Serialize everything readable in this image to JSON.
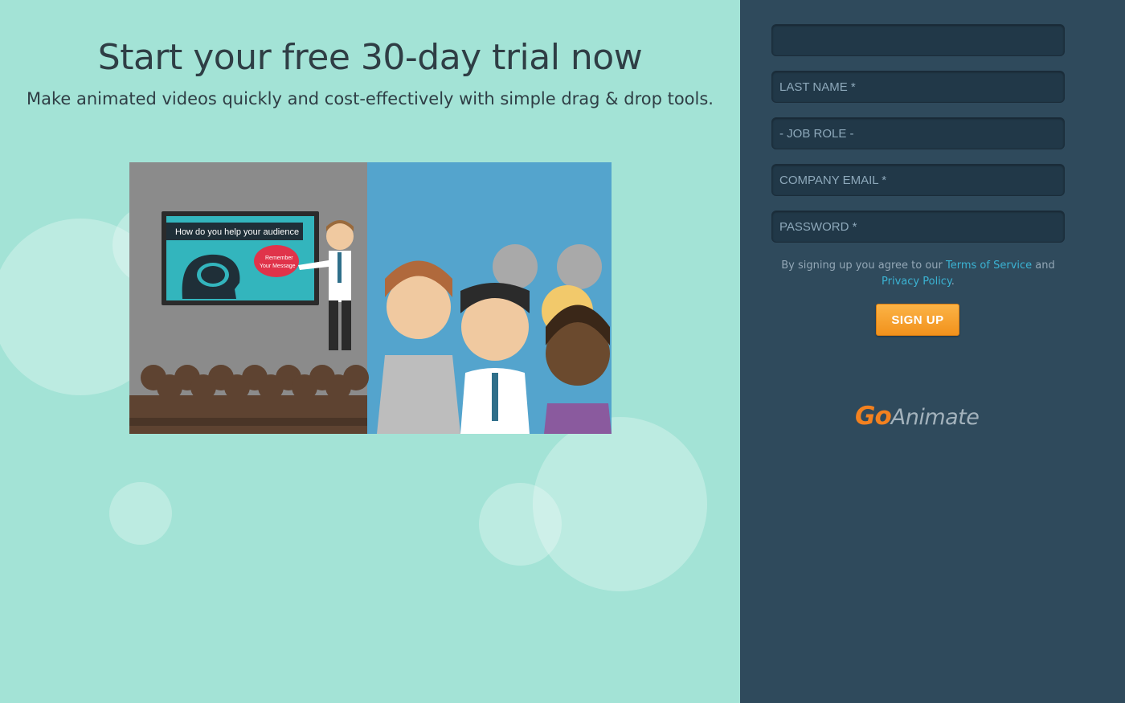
{
  "hero": {
    "title": "Start your free 30-day trial now",
    "subtitle": "Make animated videos quickly and cost-effectively with simple drag & drop tools."
  },
  "video": {
    "screen_title": "How do you help your audience",
    "speech_bubble_line1": "Remember",
    "speech_bubble_line2": "Your Message"
  },
  "form": {
    "first_field_placeholder": "",
    "last_name_placeholder": "LAST NAME *",
    "job_role_placeholder": "- JOB ROLE -",
    "company_email_placeholder": "COMPANY EMAIL *",
    "password_placeholder": "PASSWORD *",
    "terms_prefix": "By signing up you agree to our ",
    "terms_link": "Terms of Service",
    "terms_and": " and ",
    "privacy_link": "Privacy Policy",
    "terms_suffix": ".",
    "signup_label": "SIGN UP"
  },
  "logo": {
    "go": "Go",
    "animate": "Animate"
  },
  "colors": {
    "left_background": "#a3e3d6",
    "right_background": "#2f4a5c",
    "field_background": "#213848",
    "link": "#3bb3d3",
    "button": "#f2921c",
    "logo_go": "#f3811f"
  }
}
